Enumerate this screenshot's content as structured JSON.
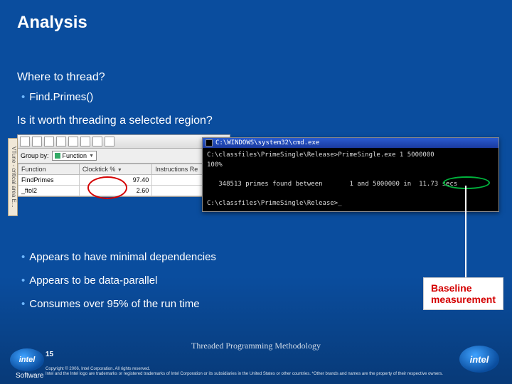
{
  "title": "Analysis",
  "q1": "Where to thread?",
  "b1": "Find.Primes()",
  "q2": "Is it worth threading a selected region?",
  "b2": "Appears to have minimal dependencies",
  "b3": "Appears to be data-parallel",
  "b4": "Consumes over 95% of the run time",
  "vtune": {
    "groupby_label": "Group by:",
    "groupby_value": "Function",
    "side_tab": "VTune - critical area E...",
    "cols": {
      "c1": "Function",
      "c2": "Clocktick %",
      "c3": "Instructions Re"
    },
    "rows": [
      {
        "fn": "FindPrimes",
        "pct": "97.40"
      },
      {
        "fn": "_ftol2",
        "pct": "2.60"
      }
    ]
  },
  "cmd": {
    "title": "C:\\WINDOWS\\system32\\cmd.exe",
    "line1": "C:\\classfiles\\PrimeSingle\\Release>PrimeSingle.exe 1 5000000",
    "line2": "100%",
    "line3a": "348513 primes found between",
    "line3b": "1 and 5000000 in",
    "line3c": "11.73 secs",
    "line4": "C:\\classfiles\\PrimeSingle\\Release>_"
  },
  "callout": {
    "l1": "Baseline",
    "l2": "measurement"
  },
  "footer": {
    "methodology": "Threaded Programming Methodology",
    "page": "15",
    "copy1": "Copyright © 2006, Intel Corporation. All rights reserved.",
    "copy2": "Intel and the Intel logo are trademarks or registered trademarks of Intel Corporation or its subsidiaries in the United States or other countries. *Other brands and names are the property of their respective owners.",
    "brand": "intel",
    "soft": "Software"
  }
}
